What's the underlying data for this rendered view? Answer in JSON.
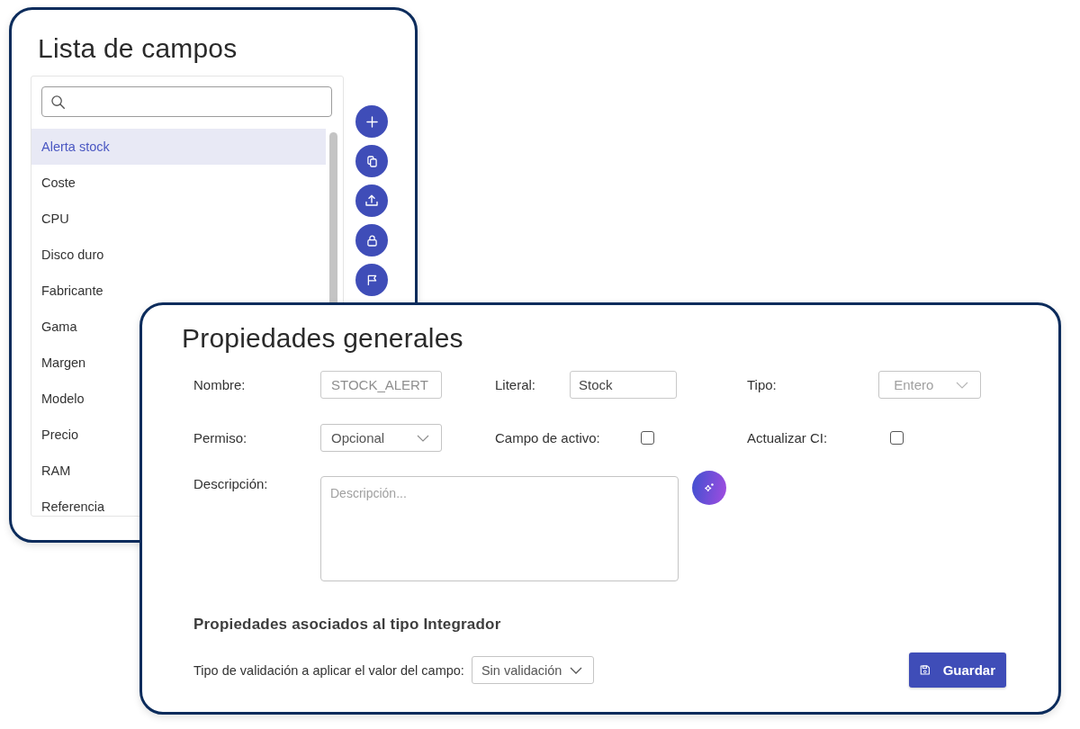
{
  "field_list": {
    "title": "Lista de campos",
    "items": [
      {
        "label": "Alerta stock",
        "selected": true
      },
      {
        "label": "Coste",
        "selected": false
      },
      {
        "label": "CPU",
        "selected": false
      },
      {
        "label": "Disco duro",
        "selected": false
      },
      {
        "label": "Fabricante",
        "selected": false
      },
      {
        "label": "Gama",
        "selected": false
      },
      {
        "label": "Margen",
        "selected": false
      },
      {
        "label": "Modelo",
        "selected": false
      },
      {
        "label": "Precio",
        "selected": false
      },
      {
        "label": "RAM",
        "selected": false
      },
      {
        "label": "Referencia",
        "selected": false
      }
    ],
    "actions": [
      {
        "kind": "add"
      },
      {
        "kind": "copy"
      },
      {
        "kind": "upload"
      },
      {
        "kind": "lock"
      },
      {
        "kind": "flag"
      }
    ]
  },
  "general_properties": {
    "title": "Propiedades generales",
    "fields": [
      {
        "kind": "text",
        "label": "Nombre:",
        "value": "STOCK_ALERT",
        "disabled": true
      },
      {
        "kind": "text",
        "label": "Literal:",
        "value": "Stock",
        "disabled": false
      },
      {
        "kind": "select",
        "label": "Tipo:",
        "value": "Entero",
        "disabled": true
      },
      {
        "kind": "select",
        "label": "Permiso:",
        "value": "Opcional",
        "disabled": false
      },
      {
        "kind": "checkbox",
        "label": "Campo de activo:",
        "checked": false
      },
      {
        "kind": "checkbox",
        "label": "Actualizar CI:",
        "checked": false
      }
    ],
    "description": {
      "label": "Descripción:",
      "placeholder": "Descripción..."
    },
    "integrator": {
      "heading": "Propiedades asociados al tipo Integrador",
      "validation": {
        "label": "Tipo de validación a aplicar el valor del campo:",
        "value": "Sin validación"
      }
    },
    "save_button": "Guardar"
  }
}
